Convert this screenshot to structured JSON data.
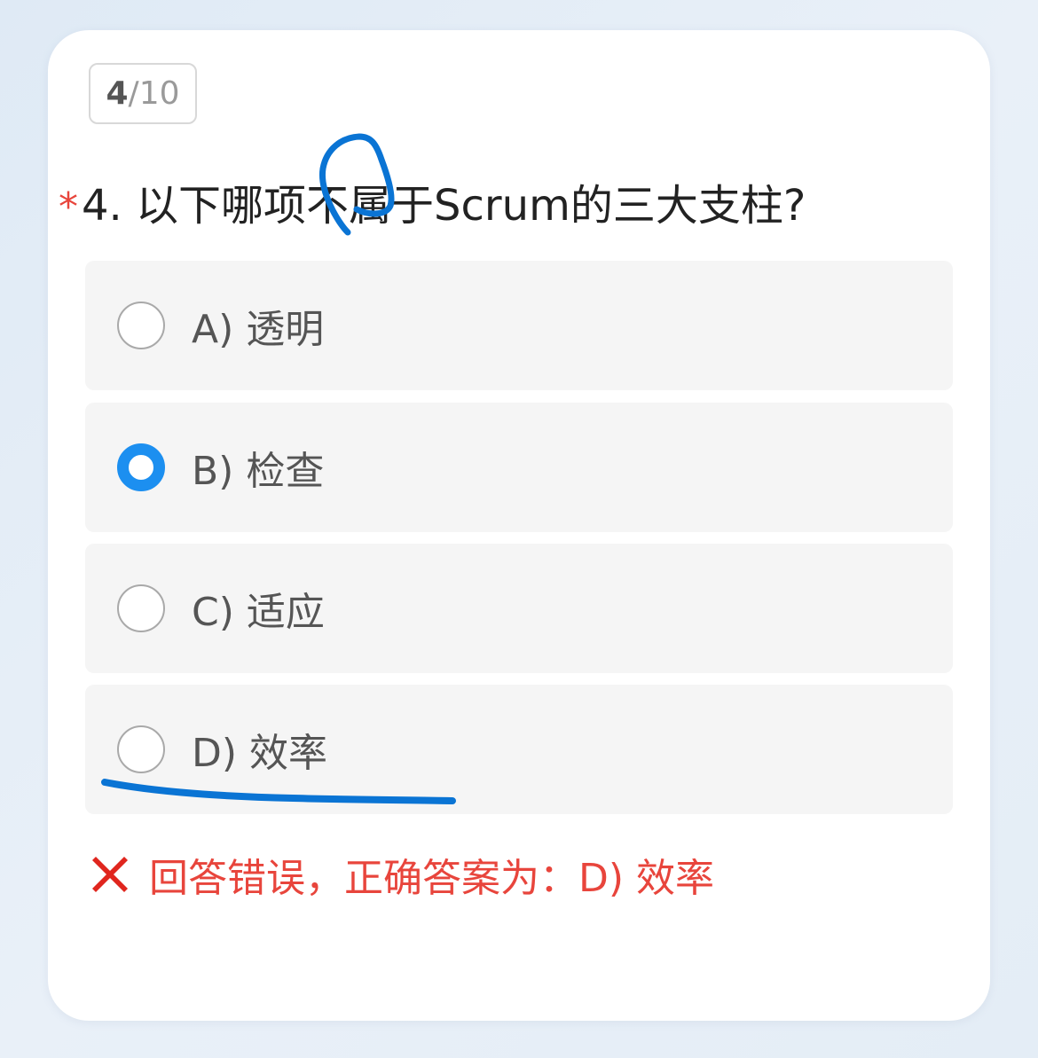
{
  "counter": {
    "current": "4",
    "separator": "/",
    "total": "10"
  },
  "question": {
    "required_mark": "*",
    "text": "4. 以下哪项不属于Scrum的三大支柱?"
  },
  "options": [
    {
      "label": "A) 透明",
      "selected": false
    },
    {
      "label": "B) 检查",
      "selected": true
    },
    {
      "label": "C) 适应",
      "selected": false
    },
    {
      "label": "D) 效率",
      "selected": false
    }
  ],
  "feedback": {
    "icon": "cross-mark-icon",
    "text": "回答错误，正确答案为：D) 效率"
  },
  "colors": {
    "accent": "#1c8ff0",
    "error": "#e8453c",
    "annotation": "#0a74d4"
  }
}
